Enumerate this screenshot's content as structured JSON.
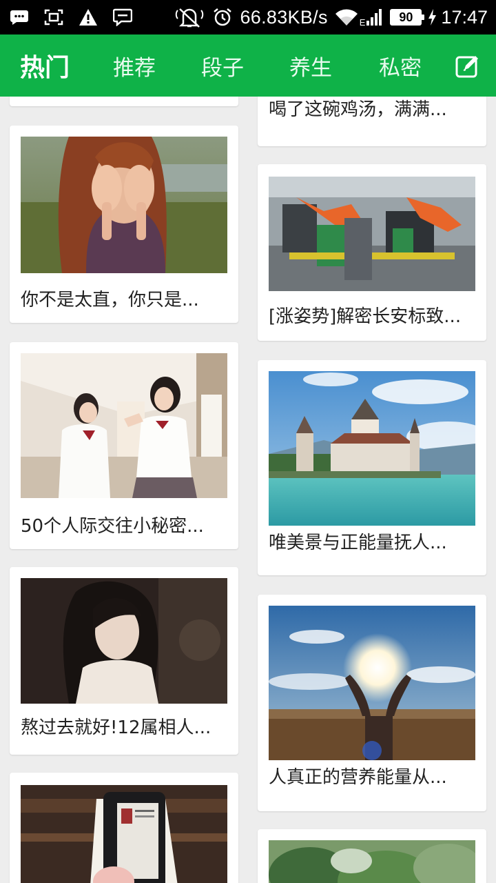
{
  "status_bar": {
    "left_icons": [
      "message-icon",
      "screenshot-icon",
      "warning-icon",
      "chat-icon"
    ],
    "right_icons": [
      "mute-icon",
      "alarm-icon",
      "wifi-icon",
      "signal-icon",
      "charging-icon"
    ],
    "net_speed": "66.83KB/s",
    "network_type": "E",
    "battery": "90",
    "time": "17:47"
  },
  "nav": {
    "tabs": [
      {
        "label": "热门",
        "active": true
      },
      {
        "label": "推荐",
        "active": false
      },
      {
        "label": "段子",
        "active": false
      },
      {
        "label": "养生",
        "active": false
      },
      {
        "label": "私密",
        "active": false
      }
    ],
    "edit_icon": "edit-icon",
    "accent_color": "#0fb248"
  },
  "feed": {
    "left": [
      {
        "title": ""
      },
      {
        "title": "你不是太直，你只是...",
        "image": "woman-covering-face"
      },
      {
        "title": "50个人际交往小秘密...",
        "image": "schoolgirls-high-five"
      },
      {
        "title": "熬过去就好!12属相人...",
        "image": "girl-looking-down"
      },
      {
        "title": "",
        "image": "phone-and-book"
      }
    ],
    "right": [
      {
        "title": "喝了这碗鸡汤，满满..."
      },
      {
        "title": "[涨姿势]解密长安标致...",
        "image": "factory-robots"
      },
      {
        "title": "唯美景与正能量抚人...",
        "image": "lakeside-castle"
      },
      {
        "title": "人真正的营养能量从...",
        "image": "hands-holding-sun"
      },
      {
        "title": "",
        "image": "green-leaves"
      }
    ]
  }
}
